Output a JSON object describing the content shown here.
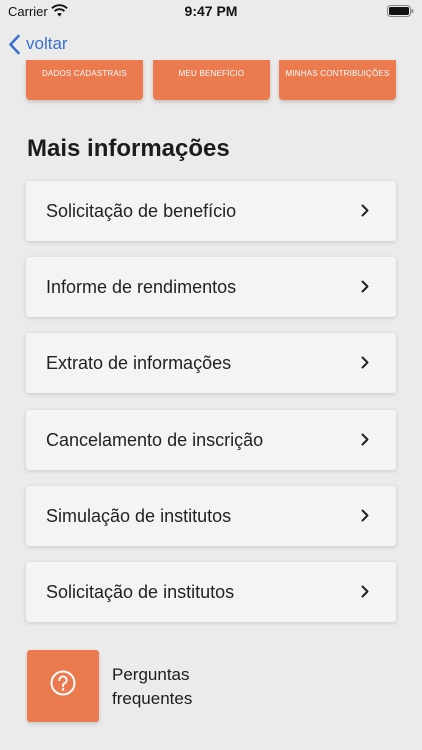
{
  "status_bar": {
    "carrier": "Carrier",
    "time": "9:47 PM"
  },
  "nav": {
    "back_label": "voltar"
  },
  "quick_tiles": [
    "DADOS CADASTRAIS",
    "MEU BENEFÍCIO",
    "MINHAS CONTRIBUIÇÕES"
  ],
  "section_title": "Mais informações",
  "menu_items": [
    "Solicitação de benefício",
    "Informe de rendimentos",
    "Extrato de informações",
    "Cancelamento de inscrição",
    "Simulação de institutos",
    "Solicitação de institutos"
  ],
  "faq": {
    "line1": "Perguntas",
    "line2": "frequentes"
  },
  "colors": {
    "accent": "#ec7a4f",
    "link": "#3b6fd1",
    "background": "#ebebeb"
  }
}
